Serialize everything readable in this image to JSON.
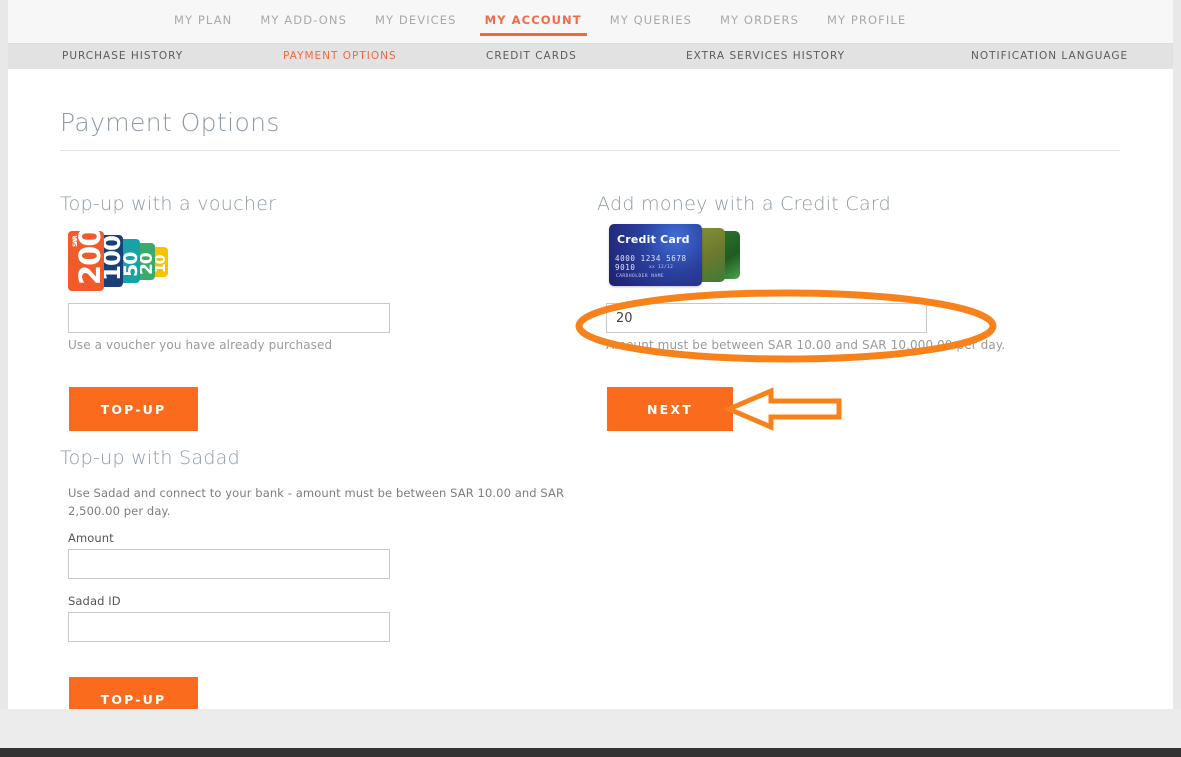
{
  "main_nav": {
    "items": [
      {
        "label": "MY PLAN",
        "active": false
      },
      {
        "label": "MY ADD-ONS",
        "active": false
      },
      {
        "label": "MY DEVICES",
        "active": false
      },
      {
        "label": "MY ACCOUNT",
        "active": true
      },
      {
        "label": "MY QUERIES",
        "active": false
      },
      {
        "label": "MY ORDERS",
        "active": false
      },
      {
        "label": "MY PROFILE",
        "active": false
      }
    ]
  },
  "sub_nav": {
    "items": [
      {
        "label": "PURCHASE HISTORY",
        "active": false
      },
      {
        "label": "PAYMENT OPTIONS",
        "active": true
      },
      {
        "label": "CREDIT CARDS",
        "active": false
      },
      {
        "label": "EXTRA SERVICES HISTORY",
        "active": false
      },
      {
        "label": "NOTIFICATION LANGUAGE",
        "active": false
      }
    ]
  },
  "page": {
    "title": "Payment Options"
  },
  "voucher_section": {
    "title": "Top-up with a voucher",
    "voucher_cards": [
      {
        "denomination": "200",
        "currency": "SAR",
        "color": "#f15a29"
      },
      {
        "denomination": "100",
        "color": "#1a3f77"
      },
      {
        "denomination": "50",
        "color": "#17a2a7"
      },
      {
        "denomination": "20",
        "color": "#3bab6a"
      },
      {
        "denomination": "10",
        "color": "#f2c500"
      }
    ],
    "voucher_input_value": "",
    "voucher_input_placeholder": "",
    "hint": "Use a voucher you have already purchased",
    "button_label": "TOP-UP"
  },
  "sadad_section": {
    "title": "Top-up with Sadad",
    "description": "Use Sadad and connect to your bank - amount must be between SAR 10.00 and SAR 2,500.00 per day.",
    "amount_label": "Amount",
    "amount_value": "",
    "amount_placeholder": "",
    "sadad_id_label": "Sadad ID",
    "sadad_id_value": "",
    "sadad_id_placeholder": "",
    "button_label": "TOP-UP"
  },
  "credit_card_section": {
    "title": "Add money with a Credit Card",
    "card_graphic": {
      "label": "Credit Card",
      "number": "4000 1234 5678 9010",
      "expiry": "xx 12/12",
      "cardholder": "CARDHOLDER NAME"
    },
    "amount_value": "20",
    "amount_placeholder": "",
    "hint": "Amount must be between SAR 10.00 and SAR 10,000.00 per day.",
    "button_label": "NEXT"
  },
  "colors": {
    "accent_orange": "#fa6b1e",
    "nav_active": "#f4683f",
    "annotation_orange": "#f7821b",
    "title_gray": "#8d99a6",
    "subnav_bg": "#e2e2e2"
  },
  "annotations": {
    "highlight_ellipse": "orange hand-drawn ellipse around the credit card amount field and hint",
    "pointer_arrow": "orange outlined left-pointing arrow pointing at the NEXT button"
  }
}
